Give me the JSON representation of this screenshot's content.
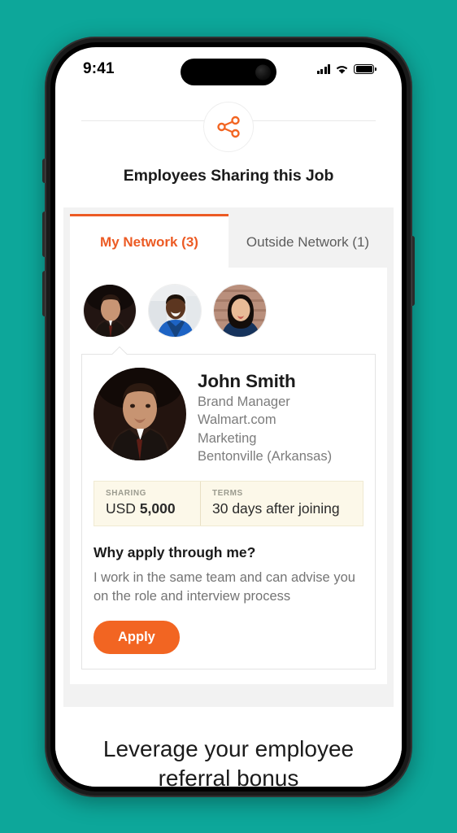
{
  "theme": {
    "background": "#0da79a",
    "accent_orange": "#f26522",
    "tab_active_orange": "#ec5b24",
    "panel_gray": "#f2f2f2",
    "terms_cream": "#fcf8e9"
  },
  "status_bar": {
    "time": "9:41",
    "cellular_icon": "cellular-bars-icon",
    "wifi_icon": "wifi-icon",
    "battery_icon": "battery-full-icon"
  },
  "header": {
    "share_icon": "share-nodes-icon",
    "title": "Employees Sharing this Job"
  },
  "tabs": [
    {
      "label": "My Network (3)",
      "active": true
    },
    {
      "label": "Outside Network (1)",
      "active": false
    }
  ],
  "avatars": [
    {
      "name": "avatar-john-smith",
      "selected": true
    },
    {
      "name": "avatar-employee-2",
      "selected": false
    },
    {
      "name": "avatar-employee-3",
      "selected": false
    }
  ],
  "person": {
    "name": "John Smith",
    "job_title": "Brand Manager",
    "company": "Walmart.com",
    "department": "Marketing",
    "location": "Bentonville (Arkansas)"
  },
  "referral": {
    "sharing_label": "SHARING",
    "sharing_currency": "USD",
    "sharing_amount": "5,000",
    "terms_label": "TERMS",
    "terms_value": "30 days after joining"
  },
  "why_apply": {
    "title": "Why apply through me?",
    "body": "I work in the same team and can advise you on the role and interview process",
    "apply_label": "Apply"
  },
  "caption": {
    "text": "Leverage your employee referral bonus"
  }
}
